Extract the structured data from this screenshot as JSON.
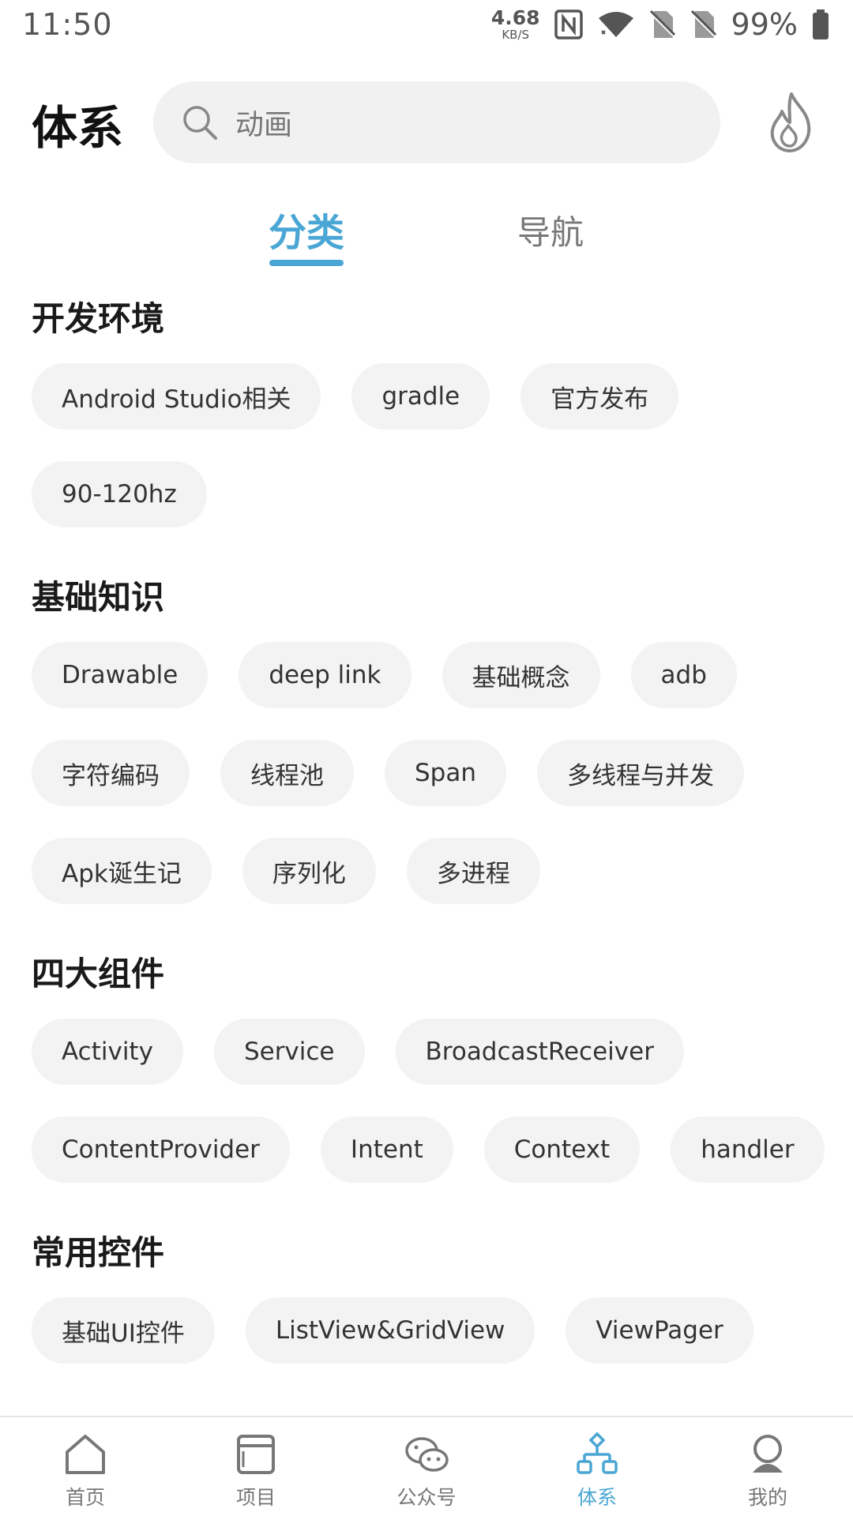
{
  "status_bar": {
    "time": "11:50",
    "speed_value": "4.68",
    "speed_unit": "KB/S",
    "battery": "99%",
    "icons": [
      "nfc-icon",
      "wifi-icon",
      "no-sim-icon",
      "no-sim-icon",
      "battery-icon"
    ]
  },
  "header": {
    "title": "体系",
    "search_placeholder": "动画",
    "hot_icon": "fire-icon"
  },
  "tabs": [
    {
      "label": "分类",
      "active": true
    },
    {
      "label": "导航",
      "active": false
    }
  ],
  "sections": [
    {
      "title": "开发环境",
      "chips": [
        "Android Studio相关",
        "gradle",
        "官方发布",
        "90-120hz"
      ]
    },
    {
      "title": "基础知识",
      "chips": [
        "Drawable",
        "deep link",
        "基础概念",
        "adb",
        "字符编码",
        "线程池",
        "Span",
        "多线程与并发",
        "Apk诞生记",
        "序列化",
        "多进程"
      ]
    },
    {
      "title": "四大组件",
      "chips": [
        "Activity",
        "Service",
        "BroadcastReceiver",
        "ContentProvider",
        "Intent",
        "Context",
        "handler"
      ]
    },
    {
      "title": "常用控件",
      "chips": [
        "基础UI控件",
        "ListView&GridView",
        "ViewPager"
      ]
    }
  ],
  "bottom_nav": [
    {
      "label": "首页",
      "icon": "home-icon",
      "active": false
    },
    {
      "label": "项目",
      "icon": "project-icon",
      "active": false
    },
    {
      "label": "公众号",
      "icon": "wechat-icon",
      "active": false
    },
    {
      "label": "体系",
      "icon": "tree-icon",
      "active": true
    },
    {
      "label": "我的",
      "icon": "profile-icon",
      "active": false
    }
  ],
  "colors": {
    "accent": "#4aa6d4",
    "chip_bg": "#f3f3f3",
    "search_bg": "#f1f1f1"
  }
}
